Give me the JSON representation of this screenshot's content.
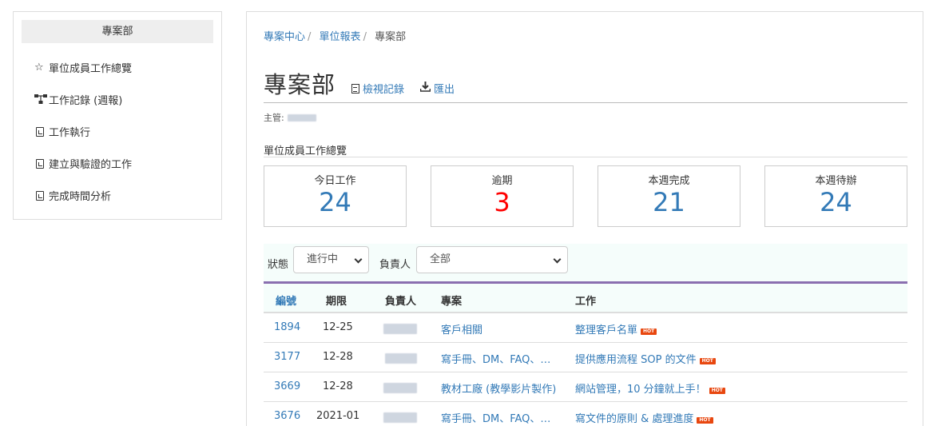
{
  "sidebar": {
    "heading": "專案部",
    "items": [
      {
        "icon": "star-icon",
        "glyph": "☆",
        "label": "單位成員工作總覽"
      },
      {
        "icon": "sitemap-icon",
        "label": "工作記錄 (週報)"
      },
      {
        "icon": "chart-file-icon",
        "label": "工作執行"
      },
      {
        "icon": "chart-file-icon",
        "label": "建立與驗證的工作"
      },
      {
        "icon": "chart-file-icon",
        "label": "完成時間分析"
      }
    ]
  },
  "breadcrumb": {
    "items": [
      "專案中心",
      "單位報表"
    ],
    "current": "專案部"
  },
  "page": {
    "title": "專案部",
    "view_log": "檢視記錄",
    "export": "匯出",
    "manager_label": "主管:",
    "section_title": "單位成員工作總覽"
  },
  "stats": [
    {
      "label": "今日工作",
      "value": "24"
    },
    {
      "label": "逾期",
      "value": "3"
    },
    {
      "label": "本週完成",
      "value": "21"
    },
    {
      "label": "本週待辦",
      "value": "24"
    }
  ],
  "filters": {
    "status_label": "狀態",
    "status_value": "進行中",
    "owner_label": "負責人",
    "owner_value": "全部"
  },
  "table": {
    "headers": [
      "編號",
      "期限",
      "負責人",
      "專案",
      "工作"
    ],
    "hot_label": "HOT",
    "rows": [
      {
        "id": "1894",
        "due": "12-25",
        "project": "客戶相關",
        "task": "整理客戶名單"
      },
      {
        "id": "3177",
        "due": "12-28",
        "project": "寫手冊、DM、FAQ、…",
        "task": "提供應用流程 SOP 的文件"
      },
      {
        "id": "3669",
        "due": "12-28",
        "project": "教材工廠 (教學影片製作)",
        "task": "網站管理，10 分鐘就上手！"
      },
      {
        "id": "3676",
        "due": "2021-01",
        "project": "寫手冊、DM、FAQ、…",
        "task": "寫文件的原則 & 處理進度"
      }
    ]
  },
  "colors": {
    "link": "#337ab7",
    "overdue": "#ff0000",
    "hot_badge": "#e8470f",
    "table_accent": "#8a6fb0"
  }
}
